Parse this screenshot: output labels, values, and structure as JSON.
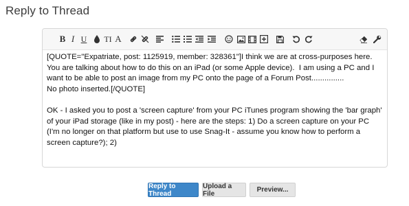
{
  "page": {
    "title": "Reply to Thread"
  },
  "toolbar": {
    "bold_label": "B",
    "italic_label": "I",
    "underline_label": "U",
    "font_size_label": "TI",
    "font_family_label": "A",
    "icons": [
      "bold-icon",
      "italic-icon",
      "underline-icon",
      "text-color-icon",
      "font-size-icon",
      "font-family-icon",
      "link-icon",
      "unlink-icon",
      "align-icon",
      "bullet-list-icon",
      "numbered-list-icon",
      "outdent-icon",
      "indent-icon",
      "smilie-icon",
      "image-icon",
      "media-icon",
      "insert-icon",
      "save-draft-icon",
      "undo-icon",
      "redo-icon",
      "remove-format-icon",
      "toggle-bbcode-icon"
    ]
  },
  "editor": {
    "paragraphs": [
      "[QUOTE=\"Expatriate, post: 1125919, member: 328361\"]I think we are at cross-purposes here.  You are talking about how to do this on an iPad (or some Apple device).  I am using a PC and I want to be able to post an image from my PC onto the page of a Forum Post...............\nNo photo inserted.[/QUOTE]",
      "OK - I asked you to post a 'screen capture' from your PC iTunes program showing the 'bar graph' of your iPad storage (like in my post) - here are the steps: 1) Do a screen capture on your PC (I'm no longer on that platform but use to use Snag-It - assume you know how to perform a screen capture?); 2)"
    ]
  },
  "buttons": {
    "reply_label": "Reply to Thread",
    "upload_label": "Upload a File",
    "preview_label": "Preview..."
  },
  "colors": {
    "primary": "#3e87c9",
    "border": "#d7d7d7"
  }
}
